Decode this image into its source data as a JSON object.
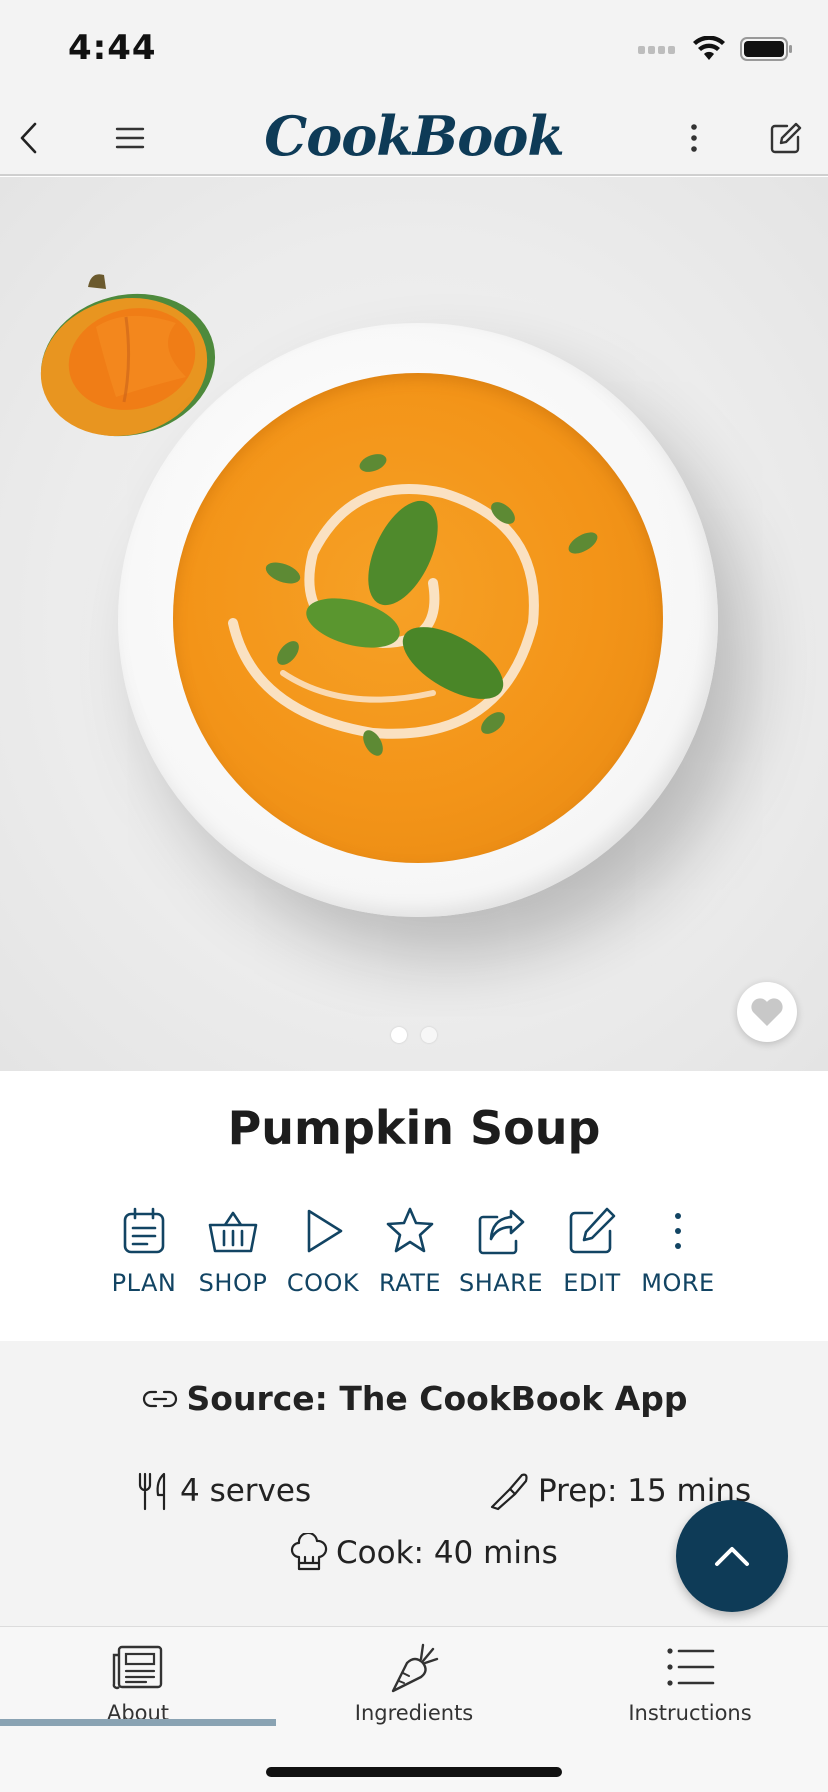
{
  "status_bar": {
    "time": "4:44"
  },
  "header": {
    "logo": "CookBook",
    "icons": [
      "back-arrow-icon",
      "menu-icon",
      "more-vertical-icon",
      "edit-icon"
    ]
  },
  "hero": {
    "image_alt_icons": [
      "pumpkin-icon",
      "soup-bowl-icon"
    ],
    "page_count": 2,
    "active_page": 1
  },
  "recipe": {
    "title": "Pumpkin Soup"
  },
  "actions": [
    {
      "label": "PLAN",
      "icon": "calendar-icon"
    },
    {
      "label": "SHOP",
      "icon": "basket-icon"
    },
    {
      "label": "COOK",
      "icon": "play-icon"
    },
    {
      "label": "RATE",
      "icon": "star-icon"
    },
    {
      "label": "SHARE",
      "icon": "share-icon"
    },
    {
      "label": "EDIT",
      "icon": "edit-icon"
    },
    {
      "label": "MORE",
      "icon": "more-vertical-icon"
    }
  ],
  "details": {
    "source": "Source: The CookBook App",
    "serves": "4 serves",
    "prep": "Prep: 15 mins",
    "cook": "Cook: 40 mins"
  },
  "tabs": [
    {
      "label": "About",
      "icon": "newspaper-icon",
      "active": true
    },
    {
      "label": "Ingredients",
      "icon": "carrot-icon",
      "active": false
    },
    {
      "label": "Instructions",
      "icon": "list-icon",
      "active": false
    }
  ],
  "colors": {
    "brand": "#0e3b57",
    "action_label": "#124463",
    "tab_indicator": "#8aa3b3",
    "soup": "#f39418"
  }
}
